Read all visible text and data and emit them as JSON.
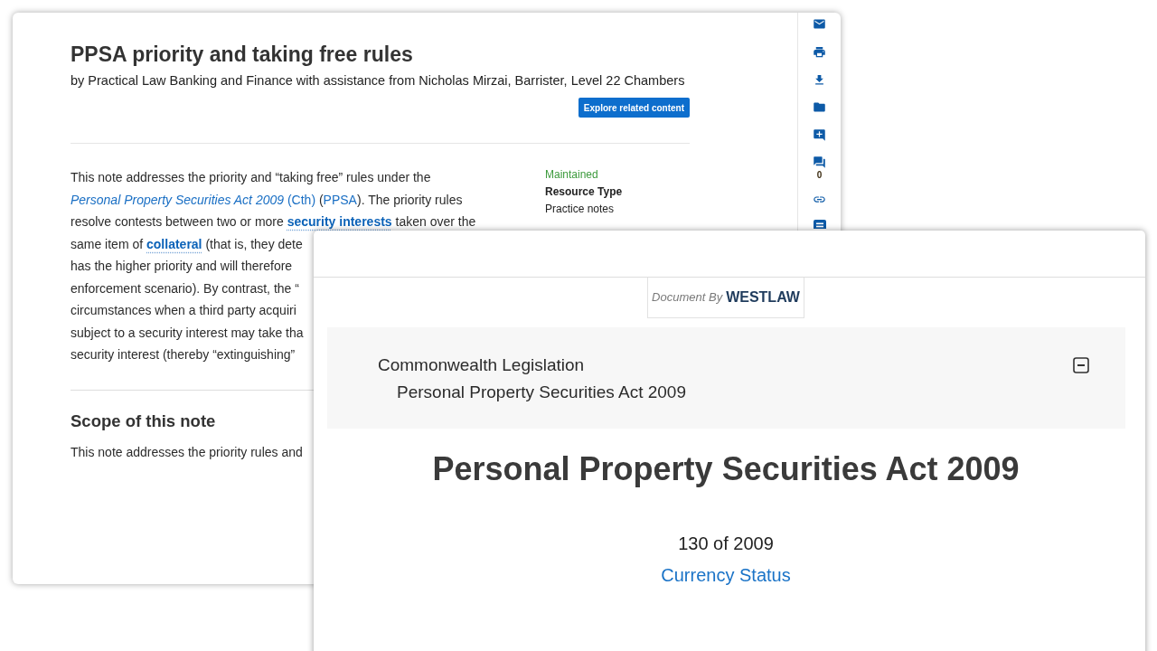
{
  "practice_note": {
    "title": "PPSA priority and taking free rules",
    "byline": "by Practical Law Banking and Finance with assistance from Nicholas Mirzai, Barrister, Level 22 Chambers",
    "explore_button": "Explore related content",
    "intro_lines": [
      {
        "segments": [
          {
            "kind": "text",
            "text": "This note addresses the priority and “taking free” rules under the"
          }
        ]
      },
      {
        "segments": [
          {
            "kind": "link",
            "text": "*Personal Property Securities Act 2009* (Cth)"
          },
          {
            "kind": "text",
            "text": " ("
          },
          {
            "kind": "link",
            "text": "PPSA"
          },
          {
            "kind": "text",
            "text": "). The priority rules"
          }
        ]
      },
      {
        "segments": [
          {
            "kind": "text",
            "text": "resolve contests between two or more "
          },
          {
            "kind": "term",
            "text": "security interests"
          },
          {
            "kind": "text",
            "text": " taken over the"
          }
        ]
      },
      {
        "segments": [
          {
            "kind": "text",
            "text": "same item of "
          },
          {
            "kind": "term",
            "text": "collateral"
          },
          {
            "kind": "text",
            "text": " (that is, they dete"
          }
        ]
      },
      {
        "segments": [
          {
            "kind": "text",
            "text": "has the higher priority and will therefore"
          }
        ]
      },
      {
        "segments": [
          {
            "kind": "text",
            "text": "enforcement scenario). By contrast, the “"
          }
        ]
      },
      {
        "segments": [
          {
            "kind": "text",
            "text": "circumstances when a third party acquiri"
          }
        ]
      },
      {
        "segments": [
          {
            "kind": "text",
            "text": "subject to a security interest may take tha"
          }
        ]
      },
      {
        "segments": [
          {
            "kind": "text",
            "text": "security interest (thereby “extinguishing”"
          }
        ]
      }
    ],
    "status": "Maintained",
    "resource_type_label": "Resource Type",
    "resource_type_value": "Practice notes",
    "section_heading": "Scope of this note",
    "section_text": "This note addresses the priority rules and",
    "toolbar": {
      "comment_count": "0"
    }
  },
  "legislation": {
    "source_badge": {
      "prefix": "Document By",
      "brand": "WESTLAW"
    },
    "breadcrumb": {
      "category": "Commonwealth Legislation",
      "item": "Personal Property Securities Act 2009",
      "expanded": true
    },
    "title": "Personal Property Securities Act 2009",
    "number": "130 of 2009",
    "currency_link": "Currency Status"
  }
}
